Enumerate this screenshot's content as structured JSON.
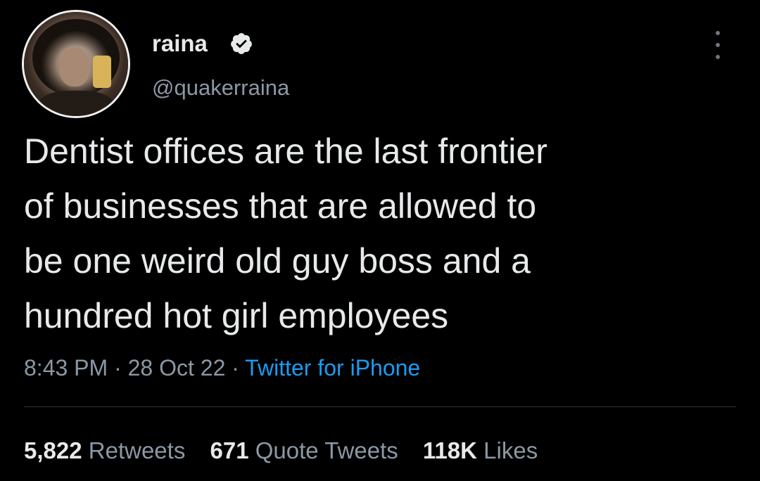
{
  "user": {
    "display_name": "raina",
    "handle": "@quakerraina",
    "verified": true
  },
  "tweet": {
    "lines": [
      "Dentist offices are the last frontier",
      "of businesses that are allowed to",
      "be one weird old guy boss and a",
      "hundred hot girl employees"
    ]
  },
  "meta": {
    "time": "8:43 PM",
    "separator": "·",
    "date": "28 Oct 22",
    "source": "Twitter for iPhone"
  },
  "stats": {
    "retweets_count": "5,822",
    "retweets_label": "Retweets",
    "quotes_count": "671",
    "quotes_label": "Quote Tweets",
    "likes_count": "118K",
    "likes_label": "Likes"
  },
  "icons": {
    "verified": "verified-badge-icon",
    "more": "more-options-icon"
  },
  "colors": {
    "background": "#000000",
    "text_primary": "#e7e9ea",
    "text_secondary": "#8b98a5",
    "link": "#1d9bf0",
    "divider": "#2f3336"
  }
}
